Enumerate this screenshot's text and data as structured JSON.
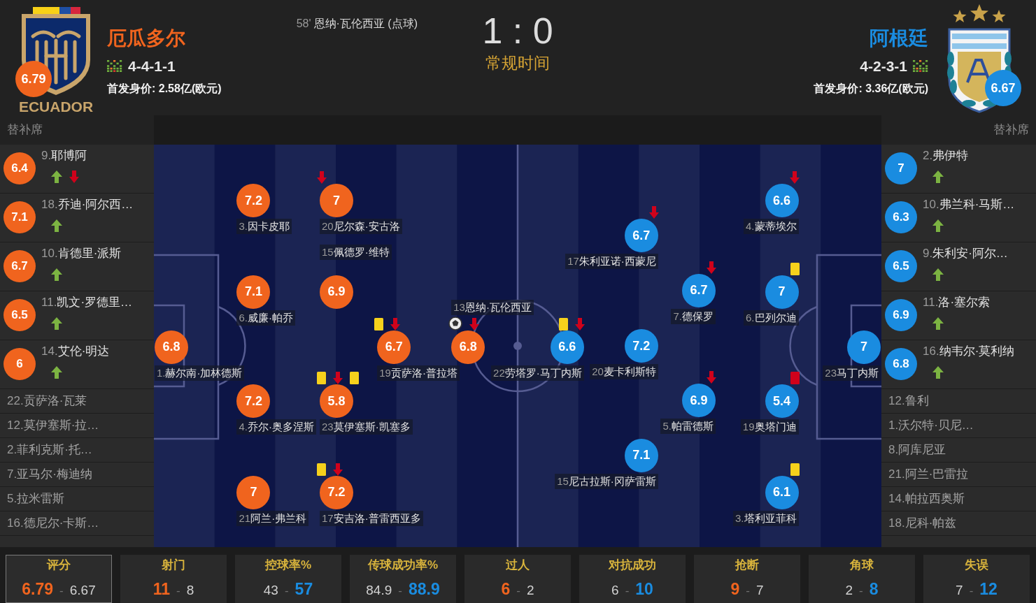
{
  "home": {
    "name": "厄瓜多尔",
    "crest_text": "ECUADOR",
    "rating": "6.79",
    "formation": "4-4-1-1",
    "market_value": "首发身价: 2.58亿(欧元)",
    "goals": [
      {
        "minute": "58'",
        "detail": "恩纳·瓦伦西亚 (点球)"
      }
    ],
    "bench_title": "替补席",
    "bench": [
      {
        "kind": "played",
        "number": "9.",
        "name": "耶博阿",
        "rating": "6.4",
        "events": [
          {
            "kind": "sub_on"
          },
          {
            "kind": "sub_off"
          }
        ]
      },
      {
        "kind": "played",
        "number": "18.",
        "name": "乔迪·阿尔西…",
        "rating": "7.1",
        "events": [
          {
            "kind": "sub_on"
          }
        ]
      },
      {
        "kind": "played",
        "number": "10.",
        "name": "肯德里·派斯",
        "rating": "6.7",
        "events": [
          {
            "kind": "sub_on"
          }
        ]
      },
      {
        "kind": "played",
        "number": "11.",
        "name": "凯文·罗德里…",
        "rating": "6.5",
        "events": [
          {
            "kind": "sub_on"
          }
        ]
      },
      {
        "kind": "played",
        "number": "14.",
        "name": "艾伦·明达",
        "rating": "6",
        "events": [
          {
            "kind": "sub_on"
          }
        ]
      },
      {
        "kind": "unused",
        "number": "22.",
        "name": "贡萨洛·瓦莱"
      },
      {
        "kind": "unused",
        "number": "12.",
        "name": "莫伊塞斯·拉…"
      },
      {
        "kind": "unused",
        "number": "2.",
        "name": "菲利克斯·托…"
      },
      {
        "kind": "unused",
        "number": "7.",
        "name": "亚马尔·梅迪纳"
      },
      {
        "kind": "unused",
        "number": "5.",
        "name": "拉米雷斯"
      },
      {
        "kind": "unused",
        "number": "16.",
        "name": "德尼尔·卡斯…"
      }
    ],
    "formation_lines": [
      [
        {
          "number": "1.",
          "name": "赫尔南·加林德斯",
          "rating": "6.8"
        }
      ],
      [
        {
          "number": "3.",
          "name": "因卡皮耶",
          "rating": "7.2"
        },
        {
          "number": "6.",
          "name": "威廉·帕乔",
          "rating": "7.1"
        },
        {
          "number": "4.",
          "name": "乔尔·奥多涅斯",
          "rating": "7.2"
        },
        {
          "number": "21",
          "name": "阿兰·弗兰科",
          "rating": "7"
        }
      ],
      [
        {
          "number": "20",
          "name": "尼尔森·安古洛",
          "rating": "7",
          "events": [
            {
              "kind": "sub_off"
            }
          ]
        },
        {
          "number": "15",
          "name": "佩德罗·维特",
          "rating": "6.9"
        },
        {
          "number": "23",
          "name": "莫伊塞斯·凯塞多",
          "rating": "5.8",
          "events": [
            {
              "kind": "card",
              "color": "#f6d11c"
            },
            {
              "kind": "sub_off"
            },
            {
              "kind": "card",
              "color": "#f6d11c"
            }
          ]
        },
        {
          "number": "17",
          "name": "安吉洛·普雷西亚多",
          "rating": "7.2",
          "events": [
            {
              "kind": "card",
              "color": "#f6d11c"
            },
            {
              "kind": "sub_off"
            }
          ]
        }
      ],
      [
        {
          "number": "19",
          "name": "贡萨洛·普拉塔",
          "rating": "6.7",
          "events": [
            {
              "kind": "card",
              "color": "#f6d11c"
            },
            {
              "kind": "sub_off"
            }
          ]
        }
      ],
      [
        {
          "number": "13",
          "name": "恩纳·瓦伦西亚",
          "rating": "6.8",
          "events": [
            {
              "kind": "penalty_goal"
            },
            {
              "kind": "sub_off"
            }
          ]
        }
      ]
    ]
  },
  "match": {
    "score": "1 : 0",
    "status": "常规时间"
  },
  "away": {
    "name": "阿根廷",
    "rating": "6.67",
    "formation": "4-2-3-1",
    "market_value": "首发身价: 3.36亿(欧元)",
    "bench_title": "替补席",
    "bench": [
      {
        "kind": "played",
        "number": "2.",
        "name": "弗伊特",
        "rating": "7",
        "events": [
          {
            "kind": "sub_on"
          }
        ]
      },
      {
        "kind": "played",
        "number": "10.",
        "name": "弗兰科·马斯…",
        "rating": "6.3",
        "events": [
          {
            "kind": "sub_on"
          }
        ]
      },
      {
        "kind": "played",
        "number": "9.",
        "name": "朱利安·阿尔…",
        "rating": "6.5",
        "events": [
          {
            "kind": "sub_on"
          }
        ]
      },
      {
        "kind": "played",
        "number": "11.",
        "name": "洛·塞尔索",
        "rating": "6.9",
        "events": [
          {
            "kind": "sub_on"
          }
        ]
      },
      {
        "kind": "played",
        "number": "16.",
        "name": "纳韦尔·莫利纳",
        "rating": "6.8",
        "events": [
          {
            "kind": "sub_on"
          }
        ]
      },
      {
        "kind": "unused",
        "number": "12.",
        "name": "鲁利"
      },
      {
        "kind": "unused",
        "number": "1.",
        "name": "沃尔特·贝尼…"
      },
      {
        "kind": "unused",
        "number": "8.",
        "name": "阿库尼亚"
      },
      {
        "kind": "unused",
        "number": "21.",
        "name": "阿兰·巴雷拉"
      },
      {
        "kind": "unused",
        "number": "14.",
        "name": "帕拉西奥斯"
      },
      {
        "kind": "unused",
        "number": "18.",
        "name": "尼科·帕兹"
      }
    ],
    "formation_lines": [
      [
        {
          "number": "22",
          "name": "劳塔罗·马丁内斯",
          "rating": "6.6",
          "events": [
            {
              "kind": "card",
              "color": "#f6d11c"
            },
            {
              "kind": "sub_off"
            }
          ]
        }
      ],
      [
        {
          "number": "17",
          "name": "朱利亚诺·西蒙尼",
          "rating": "6.7",
          "events": [
            {
              "kind": "sub_off"
            }
          ]
        },
        {
          "number": "20",
          "name": "麦卡利斯特",
          "rating": "7.2"
        },
        {
          "number": "15",
          "name": "尼古拉斯·冈萨雷斯",
          "rating": "7.1"
        }
      ],
      [
        {
          "number": "7.",
          "name": "德保罗",
          "rating": "6.7",
          "events": [
            {
              "kind": "sub_off"
            }
          ]
        },
        {
          "number": "5.",
          "name": "帕雷德斯",
          "rating": "6.9",
          "events": [
            {
              "kind": "sub_off"
            }
          ]
        }
      ],
      [
        {
          "number": "4.",
          "name": "蒙蒂埃尔",
          "rating": "6.6",
          "events": [
            {
              "kind": "sub_off"
            }
          ]
        },
        {
          "number": "6.",
          "name": "巴列尔迪",
          "rating": "7",
          "events": [
            {
              "kind": "card",
              "color": "#f6d11c"
            }
          ]
        },
        {
          "number": "19",
          "name": "奥塔门迪",
          "rating": "5.4",
          "events": [
            {
              "kind": "card",
              "color": "#d0021b"
            }
          ]
        },
        {
          "number": "3.",
          "name": "塔利亚菲科",
          "rating": "6.1",
          "events": [
            {
              "kind": "card",
              "color": "#f6d11c"
            }
          ]
        }
      ],
      [
        {
          "number": "23",
          "name": "马丁内斯",
          "rating": "7"
        }
      ]
    ]
  },
  "stats": [
    {
      "label": "评分",
      "home": {
        "value": "6.79",
        "highlighted": true
      },
      "separator": "-",
      "away": {
        "value": "6.67",
        "highlighted": false
      },
      "selected": true
    },
    {
      "label": "射门",
      "home": {
        "value": "11",
        "highlighted": true
      },
      "separator": "-",
      "away": {
        "value": "8",
        "highlighted": false
      },
      "selected": false
    },
    {
      "label": "控球率%",
      "home": {
        "value": "43",
        "highlighted": false
      },
      "separator": "-",
      "away": {
        "value": "57",
        "highlighted": true
      },
      "selected": false
    },
    {
      "label": "传球成功率%",
      "home": {
        "value": "84.9",
        "highlighted": false
      },
      "separator": "-",
      "away": {
        "value": "88.9",
        "highlighted": true
      },
      "selected": false
    },
    {
      "label": "过人",
      "home": {
        "value": "6",
        "highlighted": true
      },
      "separator": "-",
      "away": {
        "value": "2",
        "highlighted": false
      },
      "selected": false
    },
    {
      "label": "对抗成功",
      "home": {
        "value": "6",
        "highlighted": false
      },
      "separator": "-",
      "away": {
        "value": "10",
        "highlighted": true
      },
      "selected": false
    },
    {
      "label": "抢断",
      "home": {
        "value": "9",
        "highlighted": true
      },
      "separator": "-",
      "away": {
        "value": "7",
        "highlighted": false
      },
      "selected": false
    },
    {
      "label": "角球",
      "home": {
        "value": "2",
        "highlighted": false
      },
      "separator": "-",
      "away": {
        "value": "8",
        "highlighted": true
      },
      "selected": false
    },
    {
      "label": "失误",
      "home": {
        "value": "7",
        "highlighted": false
      },
      "separator": "-",
      "away": {
        "value": "12",
        "highlighted": true
      },
      "selected": false
    }
  ]
}
